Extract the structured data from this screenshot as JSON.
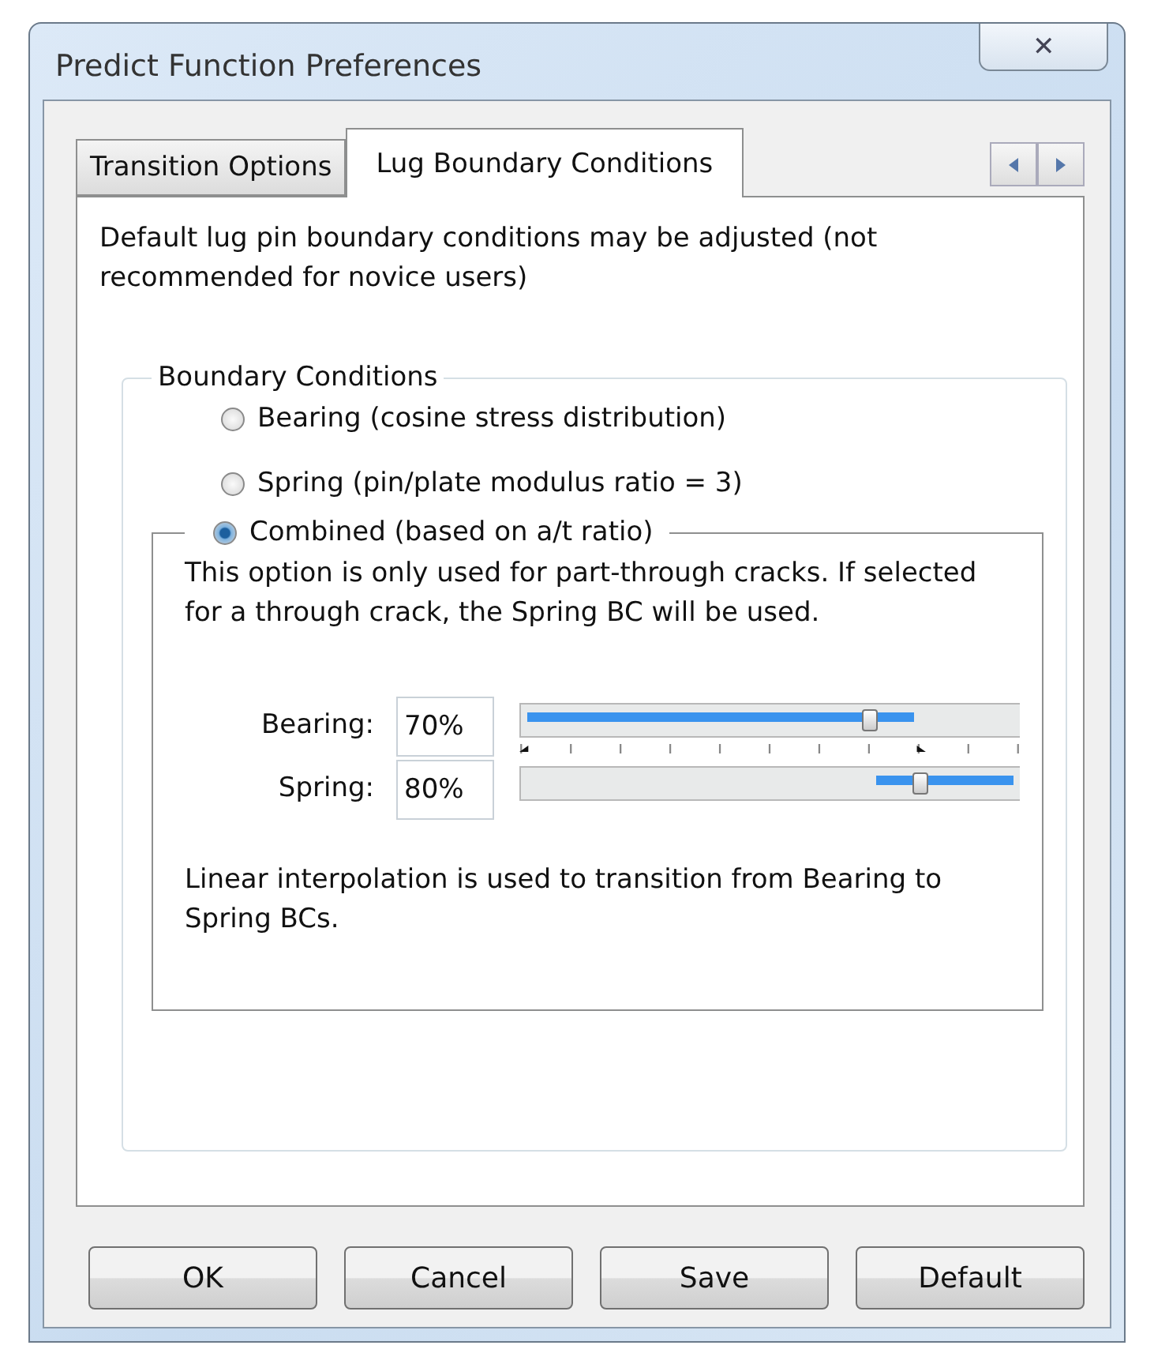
{
  "window": {
    "title": "Predict Function Preferences",
    "close": "✕"
  },
  "tabs": [
    {
      "label": "Transition Options",
      "selected": false
    },
    {
      "label": "Lug Boundary Conditions",
      "selected": true
    }
  ],
  "intro": "Default lug pin boundary conditions may be adjusted (not recommended for novice users)",
  "group": {
    "title": "Boundary Conditions",
    "options": [
      {
        "label": "Bearing (cosine stress distribution)",
        "selected": false
      },
      {
        "label": "Spring (pin/plate modulus ratio = 3)",
        "selected": false
      },
      {
        "label": "Combined (based on a/t ratio)",
        "selected": true
      }
    ]
  },
  "combined": {
    "note": "This option is only used for part-through cracks. If selected for a through crack, the Spring BC will be used.",
    "sliders": [
      {
        "label": "Bearing:",
        "value": "70%",
        "level": 0.7
      },
      {
        "label": "Spring:",
        "value": "80%",
        "level": 0.8
      }
    ],
    "footer": "Linear interpolation is used to transition from Bearing to Spring BCs."
  },
  "buttons": [
    "OK",
    "Cancel",
    "Save",
    "Default"
  ]
}
